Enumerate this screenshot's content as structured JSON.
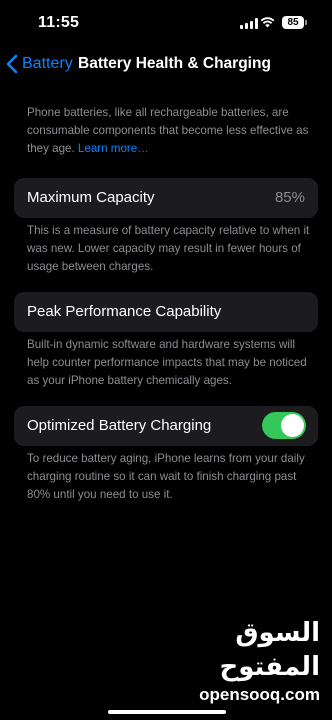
{
  "status_bar": {
    "time": "11:55",
    "battery_level": "85"
  },
  "nav": {
    "back_label": "Battery",
    "title": "Battery Health & Charging"
  },
  "intro": {
    "text": "Phone batteries, like all rechargeable batteries, are consumable components that become less effective as they age. ",
    "link": "Learn more…"
  },
  "max_capacity": {
    "label": "Maximum Capacity",
    "value": "85%",
    "footer": "This is a measure of battery capacity relative to when it was new. Lower capacity may result in fewer hours of usage between charges."
  },
  "peak_performance": {
    "label": "Peak Performance Capability",
    "footer": "Built-in dynamic software and hardware systems will help counter performance impacts that may be noticed as your iPhone battery chemically ages."
  },
  "optimized_charging": {
    "label": "Optimized Battery Charging",
    "enabled": true,
    "footer": "To reduce battery aging, iPhone learns from your daily charging routine so it can wait to finish charging past 80% until you need to use it."
  },
  "watermark": {
    "arabic": "السوق المفتوح",
    "latin": "opensooq.com"
  },
  "colors": {
    "accent": "#0a84ff",
    "toggle_on": "#34c759",
    "cell_bg": "#1c1c1e",
    "secondary_text": "#8d8d93"
  },
  "icons": {
    "back": "chevron-left-icon",
    "signal": "cellular-signal-icon",
    "wifi": "wifi-icon",
    "battery": "battery-icon"
  }
}
